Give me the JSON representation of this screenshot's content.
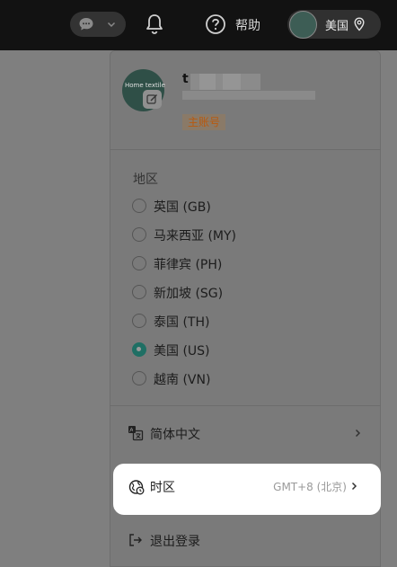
{
  "topbar": {
    "help_label": "帮助",
    "region_label": "美国"
  },
  "profile": {
    "avatar_text": "Home textile",
    "username_initial": "t",
    "role_tag": "主账号"
  },
  "region": {
    "title": "地区",
    "options": [
      {
        "label": "英国 (GB)",
        "selected": false
      },
      {
        "label": "马来西亚 (MY)",
        "selected": false
      },
      {
        "label": "菲律宾 (PH)",
        "selected": false
      },
      {
        "label": "新加坡 (SG)",
        "selected": false
      },
      {
        "label": "泰国 (TH)",
        "selected": false
      },
      {
        "label": "美国 (US)",
        "selected": true
      },
      {
        "label": "越南 (VN)",
        "selected": false
      }
    ]
  },
  "menu": {
    "language_label": "简体中文",
    "timezone_label": "时区",
    "timezone_value": "GMT+8 (北京)",
    "logout_label": "退出登录"
  },
  "colors": {
    "accent": "#1f6f64",
    "tag_text": "#b85a10"
  }
}
